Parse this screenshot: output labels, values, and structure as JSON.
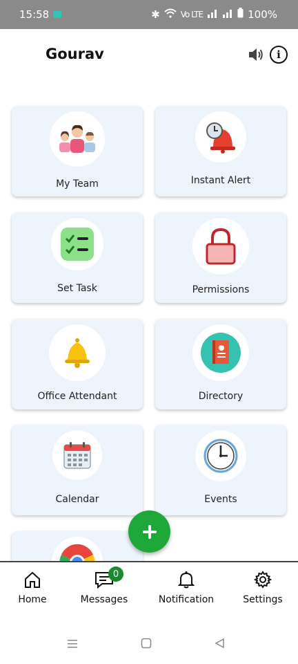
{
  "status_bar": {
    "time": "15:58",
    "battery": "100%"
  },
  "header": {
    "title": "Gourav"
  },
  "tiles": [
    {
      "label": "My Team",
      "icon": "team-icon"
    },
    {
      "label": "Instant Alert",
      "icon": "alarm-bell-icon"
    },
    {
      "label": "Set Task",
      "icon": "checklist-icon"
    },
    {
      "label": "Permissions",
      "icon": "lock-icon"
    },
    {
      "label": "Office Attendant",
      "icon": "bell-icon"
    },
    {
      "label": "Directory",
      "icon": "address-book-icon"
    },
    {
      "label": "Calendar",
      "icon": "calendar-icon"
    },
    {
      "label": "Events",
      "icon": "clock-icon"
    },
    {
      "label": "",
      "icon": "chrome-icon"
    }
  ],
  "bottom_nav": [
    {
      "label": "Home",
      "icon": "home-icon"
    },
    {
      "label": "Messages",
      "icon": "messages-icon",
      "badge": "0"
    },
    {
      "label": "Notification",
      "icon": "notification-bell-icon"
    },
    {
      "label": "Settings",
      "icon": "gear-icon"
    }
  ],
  "colors": {
    "fab": "#1ea83a",
    "tile_bg": "#eef4fb",
    "badge": "#1a8a2e"
  }
}
